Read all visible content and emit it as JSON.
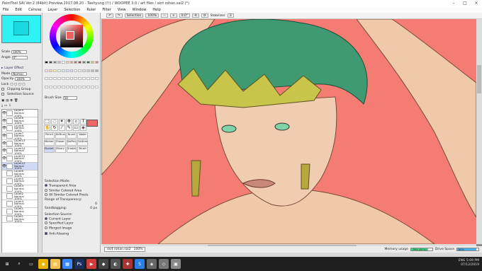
{
  "window": {
    "title": "PaintTool SAI Ver.2 (64bit) Preview.2017.08.20 - Taehyung (!!) / WOOPEE 3.0 / art files / skrt rohan.sai2 (*)",
    "controls": [
      "–",
      "□",
      "×"
    ]
  },
  "menu": [
    "File",
    "Edit",
    "Canvas",
    "Layer",
    "Selection",
    "Ruler",
    "Filter",
    "View",
    "Window",
    "Help"
  ],
  "toolbar": {
    "selection_label": "Selection",
    "zoom": "100%",
    "angle": "0.0°",
    "stabilizer_label": "Stabilizer",
    "stabilizer_value": "3"
  },
  "left_panel": {
    "scale_label": "Scale",
    "scale_value": "100%",
    "angle_label": "Angle",
    "angle_value": "0°",
    "layer_effect": "Layer Effect",
    "mode_label": "Mode",
    "mode_value": "Normal",
    "opacity_label": "Opacity",
    "opacity_value": "100%",
    "lock_label": "Lock",
    "clipping_group": "Clipping Group",
    "selection_source": "Selection Source",
    "layers": [
      {
        "name": "Layer9",
        "mode": "Normal",
        "opacity": "100%",
        "visible": true,
        "selected": false
      },
      {
        "name": "Layer8",
        "mode": "Normal",
        "opacity": "100%",
        "visible": true,
        "selected": false
      },
      {
        "name": "Layer6",
        "mode": "Normal",
        "opacity": "100%",
        "visible": true,
        "selected": false
      },
      {
        "name": "Layer7",
        "mode": "Normal",
        "opacity": "100%",
        "visible": true,
        "selected": false
      },
      {
        "name": "Layer13",
        "mode": "Normal",
        "opacity": "100%",
        "visible": true,
        "selected": false
      },
      {
        "name": "Layer14",
        "mode": "Normal",
        "opacity": "100%",
        "visible": true,
        "selected": false
      },
      {
        "name": "Layer15",
        "mode": "Normal",
        "opacity": "100%",
        "visible": true,
        "selected": false
      },
      {
        "name": "Layer12",
        "mode": "Normal",
        "opacity": "100%",
        "visible": true,
        "selected": true
      },
      {
        "name": "Layer6",
        "mode": "Normal",
        "opacity": "100%",
        "visible": false,
        "selected": false
      },
      {
        "name": "Layer5",
        "mode": "Normal",
        "opacity": "100%",
        "visible": false,
        "selected": false
      },
      {
        "name": "Layer3",
        "mode": "Normal",
        "opacity": "100%",
        "visible": false,
        "selected": false
      },
      {
        "name": "Layer2",
        "mode": "Normal",
        "opacity": "100%",
        "visible": false,
        "selected": false
      },
      {
        "name": "Layer4",
        "mode": "Normal",
        "opacity": "100%",
        "visible": false,
        "selected": false
      },
      {
        "name": "Layer1",
        "mode": "Normal",
        "opacity": "100%",
        "visible": false,
        "selected": false
      },
      {
        "name": "Layer1",
        "mode": "Normal",
        "opacity": "100%",
        "visible": false,
        "selected": false
      }
    ]
  },
  "tool_panel": {
    "brush_size_label": "Brush Size",
    "brush_size_value": "50",
    "brushes": [
      "Pencil",
      "AirBrush",
      "Brush",
      "Water",
      "Marker",
      "Eraser",
      "SelPen",
      "SelEras",
      "Bucket",
      "Binary",
      "Gradation",
      "Brush"
    ],
    "selection_mode_label": "Selection Mode:",
    "selection_modes": [
      "Transparent Area",
      "Similar Colored Area",
      "All Similar Colored Pixels"
    ],
    "range_label": "Range of Transparency:",
    "range_value": "0",
    "sandbagging_label": "Sandbagging:",
    "sandbagging_value": "0 px",
    "source_label": "Selection Source:",
    "sources": [
      "Current Layer",
      "Specified Layer",
      "Merged Image"
    ],
    "anti_aliasing": "Anti-Aliasing"
  },
  "swatch_colors": [
    "#000000",
    "#404040",
    "#808080",
    "#c0c0c0",
    "#ffffff",
    "#f4c9a8",
    "#e59a7d",
    "#c76e5e",
    "#8b4a3f",
    "#5a8f5a",
    "#2f6e4a",
    "#d8c04a",
    "#f47c73",
    "#ffe0e0",
    "#ffd0b0",
    "#ffeeaa",
    "#e0ffe0",
    "#d0f0ff",
    "#e0e0ff",
    "#f0d0ff",
    "#ffffff",
    "#eeeeee",
    "#dddddd",
    "#cccccc",
    "#bbbbbb",
    "#aaaaaa"
  ],
  "status": {
    "file_tab": "skrt rohan.sai2",
    "file_zoom": "100%",
    "memory_label": "Memory usage",
    "memory_value": "79% (81%)",
    "memory_fraction": 0.79,
    "drive_label": "Drive Space",
    "drive_value": "90%",
    "drive_fraction": 0.9
  },
  "taskbar": {
    "icons": [
      "windows-icon",
      "search-icon",
      "task-view-icon",
      "chrome-icon",
      "folder-icon",
      "store-icon",
      "photoshop-icon",
      "media-icon",
      "app-icon",
      "paint-icon",
      "game-icon",
      "sai-icon",
      "app2-icon",
      "app3-icon",
      "app4-icon"
    ],
    "time": "5:09 PM",
    "date": "07/12/2019",
    "lang": "ENG"
  }
}
